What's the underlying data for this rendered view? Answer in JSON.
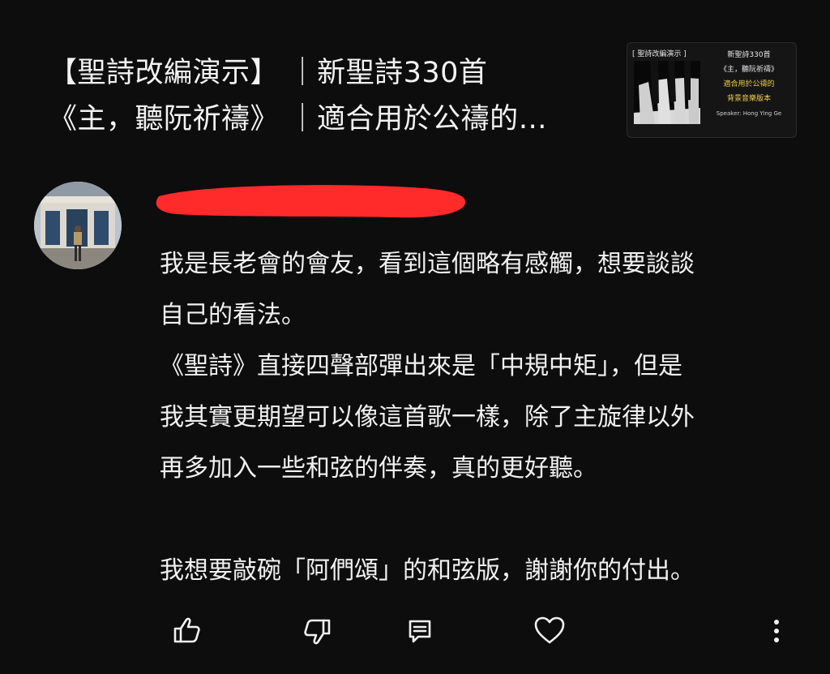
{
  "video": {
    "title_line_1": "【聖詩改編演示】 ｜新聖詩330首",
    "title_line_2": "《主，聽阮祈禱》 ｜適合用於公禱的…",
    "thumbnail": {
      "left_title": "[ 聖詩改編演示 ]",
      "right_lines": [
        "新聖詩330首",
        "《主，聽阮祈禱》",
        "適合用於公禱的",
        "背景音樂版本",
        "Speaker: Hong Ying Ge"
      ]
    }
  },
  "comment": {
    "lines": [
      "我是長老會的會友，看到這個略有感觸，想要談談",
      "自己的看法。",
      "《聖詩》直接四聲部彈出來是「中規中矩」，但是",
      "我其實更期望可以像這首歌一樣，除了主旋律以外",
      "再多加入一些和弦的伴奏，真的更好聽。",
      "",
      "我想要敲碗「阿們頌」的和弦版，謝謝你的付出。"
    ]
  },
  "actions": {
    "icons": [
      "thumbs-up-icon",
      "thumbs-down-icon",
      "reply-icon",
      "heart-icon",
      "more-vertical-icon"
    ]
  },
  "colors": {
    "background": "#0d0d0d",
    "text": "#f1f1f1",
    "redaction": "#ff2a2a",
    "thumbnail_accent": "#f2cf48"
  }
}
